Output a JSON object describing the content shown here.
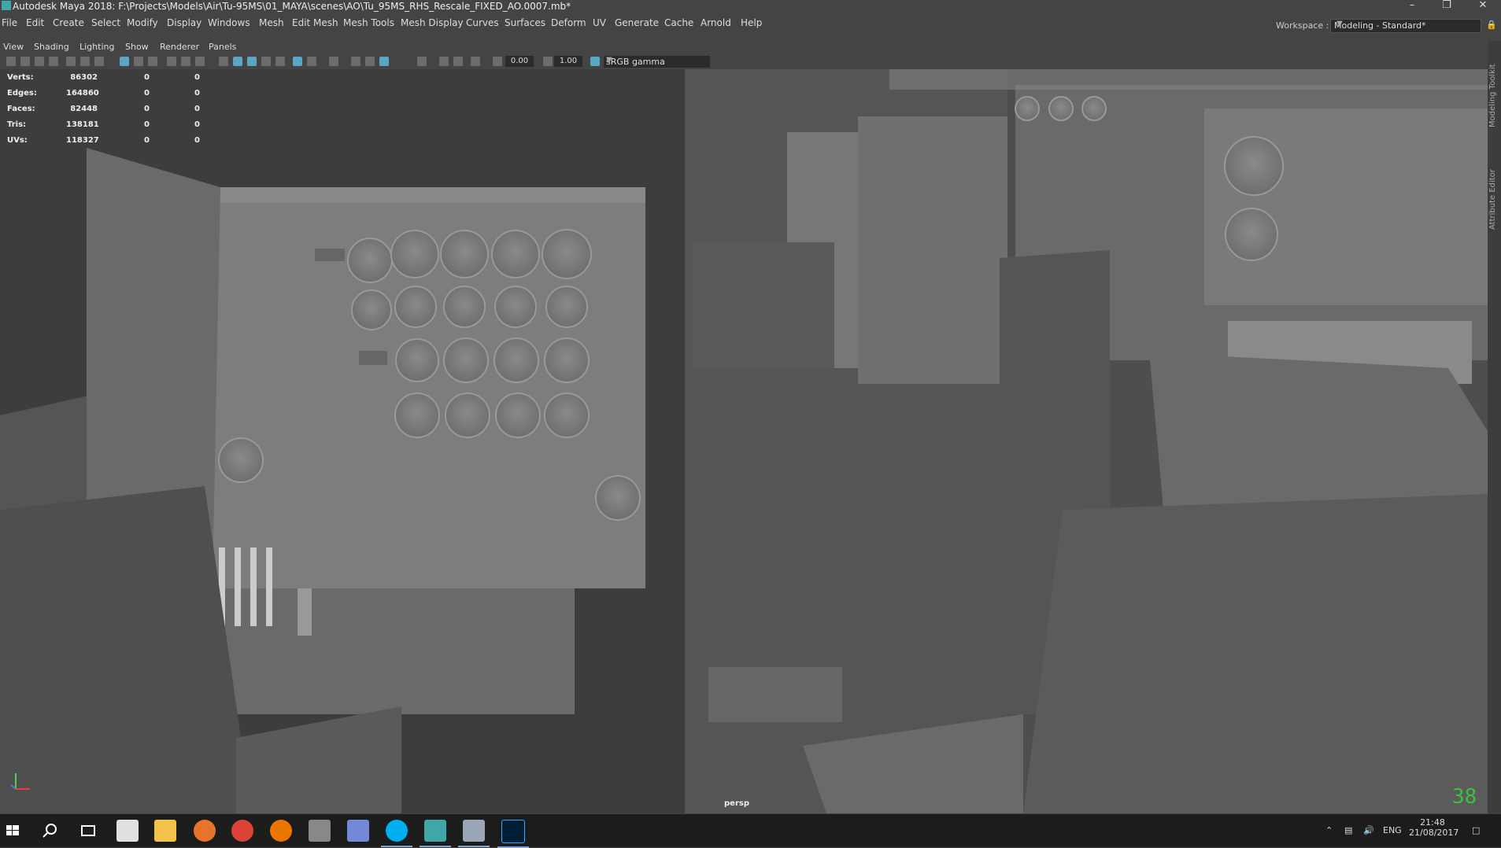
{
  "window": {
    "title": "Autodesk Maya 2018: F:\\Projects\\Models\\Air\\Tu-95MS\\01_MAYA\\scenes\\AO\\Tu_95MS_RHS_Rescale_FIXED_AO.0007.mb*",
    "controls": {
      "minimize": "–",
      "restore": "❐",
      "close": "✕"
    }
  },
  "menubar": {
    "items": [
      "File",
      "Edit",
      "Create",
      "Select",
      "Modify",
      "Display",
      "Windows",
      "Mesh",
      "Edit Mesh",
      "Mesh Tools",
      "Mesh Display",
      "Curves",
      "Surfaces",
      "Deform",
      "UV",
      "Generate",
      "Cache",
      "Arnold",
      "Help"
    ],
    "workspace_label": "Workspace :",
    "workspace_value": "Modeling - Standard*"
  },
  "panel_menu": {
    "items": [
      "View",
      "Shading",
      "Lighting",
      "Show",
      "Renderer",
      "Panels"
    ]
  },
  "viewport_toolbar": {
    "exposure": "0.00",
    "gamma": "1.00",
    "color_space": "sRGB gamma"
  },
  "hud": {
    "rows": [
      {
        "label": "Verts:",
        "v1": "86302",
        "v2": "0",
        "v3": "0"
      },
      {
        "label": "Edges:",
        "v1": "164860",
        "v2": "0",
        "v3": "0"
      },
      {
        "label": "Faces:",
        "v1": "82448",
        "v2": "0",
        "v3": "0"
      },
      {
        "label": "Tris:",
        "v1": "138181",
        "v2": "0",
        "v3": "0"
      },
      {
        "label": "UVs:",
        "v1": "118327",
        "v2": "0",
        "v3": "0"
      }
    ]
  },
  "viewport": {
    "camera": "persp",
    "corner_number": "38"
  },
  "side_tabs": [
    "Modeling Toolkit",
    "Attribute Editor"
  ],
  "taskbar": {
    "apps": [
      "start-icon",
      "search-icon",
      "task-view-icon",
      "mail-icon",
      "file-explorer-icon",
      "firefox-icon",
      "chrome-icon",
      "blender-icon",
      "app-icon",
      "discord-icon",
      "skype-icon",
      "maya-icon",
      "photos-icon",
      "photoshop-icon"
    ],
    "lang": "ENG",
    "time": "21:48",
    "date": "21/08/2017"
  }
}
